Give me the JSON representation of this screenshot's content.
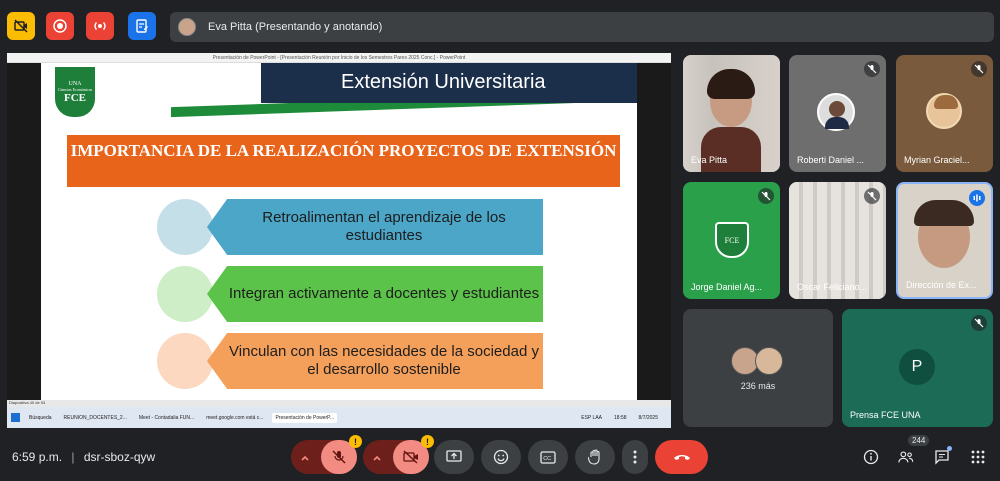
{
  "topbar": {
    "presenter_text": "Eva Pitta (Presentando y anotando)"
  },
  "ppt": {
    "window_title": "Presentación de PowerPoint - [Presentación Reunión por Inicio de los Semestres Pares 2025 Conc.] - PowerPoint",
    "slide_title": "Extensión Universitaria",
    "logo": {
      "top": "UNA",
      "mid": "Ciencias Económicas",
      "big": "FCE"
    },
    "importance_heading": "IMPORTANCIA DE LA REALIZACIÓN PROYECTOS DE EXTENSIÓN",
    "items": [
      {
        "text": "Retroalimentan el aprendizaje de los estudiantes",
        "bar_color": "#4ba6c8",
        "circle_color": "#c5dfe9"
      },
      {
        "text": "Integran activamente a docentes y estudiantes",
        "bar_color": "#5cc34a",
        "circle_color": "#cdeec6"
      },
      {
        "text": "Vinculan con las necesidades de la sociedad y el desarrollo sostenible",
        "bar_color": "#f5a05a",
        "circle_color": "#fbd8bf"
      }
    ],
    "status_left": "Diapositiva 40 de 53",
    "taskbar": {
      "search": "Búsqueda",
      "items": [
        "REUNION_DOCENTES_2...",
        "Meet - Contadalia FUN...",
        "meet.google.com está c...",
        "Presentación de PowerP..."
      ],
      "lang": "ESP LAA",
      "time": "18:58",
      "date": "8/7/2025"
    }
  },
  "participants": [
    {
      "name": "Eva Pitta"
    },
    {
      "name": "Roberti Daniel ..."
    },
    {
      "name": "Myrian Graciel..."
    },
    {
      "name": "Jorge Daniel Ag..."
    },
    {
      "name": "Oscar Feliciano..."
    },
    {
      "name": "Dirección de Ex..."
    }
  ],
  "more_tile": {
    "label": "236 más"
  },
  "prensa_tile": {
    "initial": "P",
    "name": "Prensa FCE UNA"
  },
  "bottom": {
    "time": "6:59 p.m.",
    "separator": "|",
    "meeting_code": "dsr-sboz-qyw",
    "participant_count": "244"
  },
  "colors": {
    "end_call": "#ea4335",
    "muted_red": "#f28b82",
    "muted_dark_red": "#6d1f1b",
    "control_bg": "#3c4043",
    "prensa_bg": "#1b6b56",
    "prensa_avatar": "#0f4f3f"
  }
}
